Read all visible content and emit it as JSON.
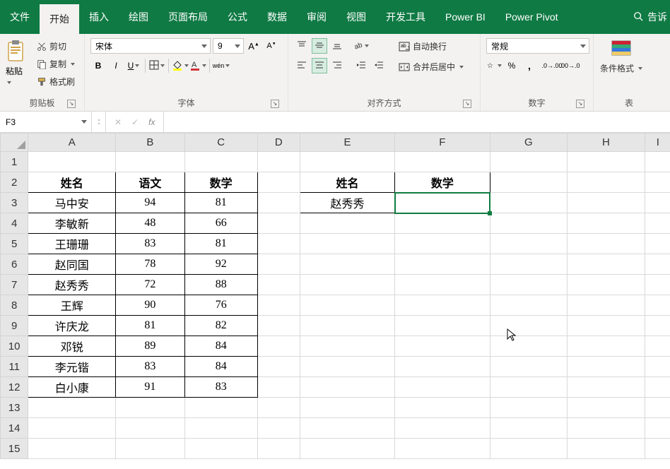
{
  "tabs": {
    "file": "文件",
    "home": "开始",
    "insert": "插入",
    "draw": "绘图",
    "layout": "页面布局",
    "formulas": "公式",
    "data": "数据",
    "review": "审阅",
    "view": "视图",
    "developer": "开发工具",
    "powerbi": "Power BI",
    "powerpivot": "Power Pivot",
    "tell": "告诉"
  },
  "ribbon": {
    "clipboard": {
      "paste": "粘贴",
      "cut": "剪切",
      "copy": "复制",
      "format_painter": "格式刷",
      "group": "剪贴板"
    },
    "font": {
      "name": "宋体",
      "size": "9",
      "wen": "wén",
      "group": "字体"
    },
    "alignment": {
      "wrap": "自动换行",
      "merge": "合并后居中",
      "group": "对齐方式"
    },
    "number": {
      "format": "常规",
      "group": "数字"
    },
    "styles": {
      "cond": "条件格式",
      "tbl": "表"
    }
  },
  "namebox": "F3",
  "formula": "",
  "columns": [
    "A",
    "B",
    "C",
    "D",
    "E",
    "F",
    "G",
    "H",
    "I"
  ],
  "rows": [
    "1",
    "2",
    "3",
    "4",
    "5",
    "6",
    "7",
    "8",
    "9",
    "10",
    "11",
    "12",
    "13",
    "14",
    "15"
  ],
  "table1": {
    "headers": [
      "姓名",
      "语文",
      "数学"
    ],
    "data": [
      [
        "马中安",
        "94",
        "81"
      ],
      [
        "李敏新",
        "48",
        "66"
      ],
      [
        "王珊珊",
        "83",
        "81"
      ],
      [
        "赵同国",
        "78",
        "92"
      ],
      [
        "赵秀秀",
        "72",
        "88"
      ],
      [
        "王辉",
        "90",
        "76"
      ],
      [
        "许庆龙",
        "81",
        "82"
      ],
      [
        "邓锐",
        "89",
        "84"
      ],
      [
        "李元锴",
        "83",
        "84"
      ],
      [
        "白小康",
        "91",
        "83"
      ]
    ]
  },
  "table2": {
    "headers": [
      "姓名",
      "数学"
    ],
    "data": [
      [
        "赵秀秀",
        ""
      ]
    ]
  },
  "active_cell": "F3",
  "chart_data": {
    "type": "table",
    "title": "",
    "columns": [
      "姓名",
      "语文",
      "数学"
    ],
    "rows": [
      {
        "姓名": "马中安",
        "语文": 94,
        "数学": 81
      },
      {
        "姓名": "李敏新",
        "语文": 48,
        "数学": 66
      },
      {
        "姓名": "王珊珊",
        "语文": 83,
        "数学": 81
      },
      {
        "姓名": "赵同国",
        "语文": 78,
        "数学": 92
      },
      {
        "姓名": "赵秀秀",
        "语文": 72,
        "数学": 88
      },
      {
        "姓名": "王辉",
        "语文": 90,
        "数学": 76
      },
      {
        "姓名": "许庆龙",
        "语文": 81,
        "数学": 82
      },
      {
        "姓名": "邓锐",
        "语文": 89,
        "数学": 84
      },
      {
        "姓名": "李元锴",
        "语文": 83,
        "数学": 84
      },
      {
        "姓名": "白小康",
        "语文": 91,
        "数学": 83
      }
    ],
    "lookup_table": {
      "columns": [
        "姓名",
        "数学"
      ],
      "rows": [
        {
          "姓名": "赵秀秀",
          "数学": null
        }
      ]
    }
  }
}
